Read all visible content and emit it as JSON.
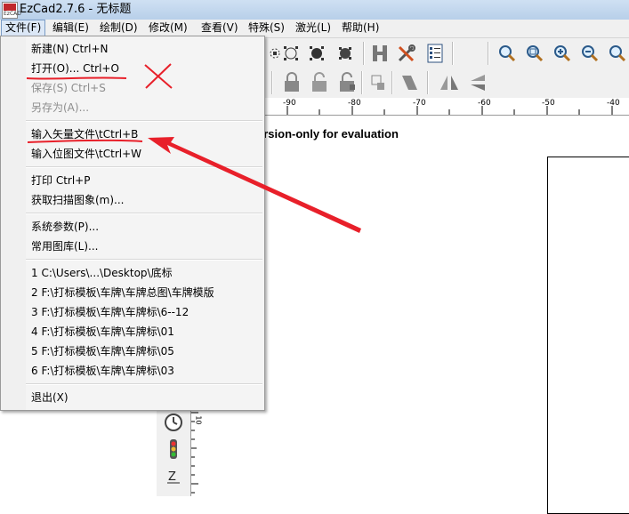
{
  "window": {
    "title": "EzCad2.7.6 - 无标题",
    "logo_text": "EzCAD"
  },
  "menu": [
    "文件(F)",
    "编辑(E)",
    "绘制(D)",
    "修改(M)",
    "查看(V)",
    "特殊(S)",
    "激光(L)",
    "帮助(H)"
  ],
  "file_menu": {
    "new": "新建(N) Ctrl+N",
    "open": "打开(O)... Ctrl+O",
    "save": "保存(S) Ctrl+S",
    "save_as": "另存为(A)...",
    "import_vector": "输入矢量文件\\tCtrl+B",
    "import_bitmap": "输入位图文件\\tCtrl+W",
    "print": "打印 Ctrl+P",
    "scan": "获取扫描图象(m)...",
    "system_params": "系统参数(P)...",
    "library": "常用图库(L)...",
    "recent": [
      "1 C:\\Users\\...\\Desktop\\底标",
      "2 F:\\打标模板\\车牌\\车牌总图\\车牌模版",
      "3 F:\\打标模板\\车牌\\车牌标\\6--12",
      "4 F:\\打标模板\\车牌\\车牌标\\01",
      "5 F:\\打标模板\\车牌\\车牌标\\05",
      "6 F:\\打标模板\\车牌\\车牌标\\03"
    ],
    "exit": "退出(X)"
  },
  "ruler": {
    "labels": [
      "-90",
      "-80",
      "-70",
      "-60",
      "-50",
      "-40"
    ],
    "vertical_label": "10"
  },
  "canvas": {
    "note": "ersion-only for evaluation"
  },
  "annotations": {
    "color": "#e8202a"
  }
}
